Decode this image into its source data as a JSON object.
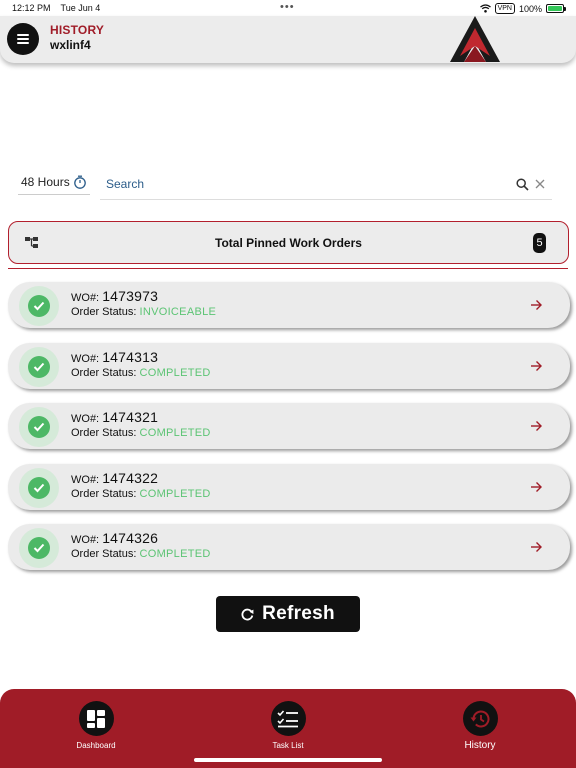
{
  "status_bar": {
    "time": "12:12 PM",
    "date": "Tue Jun 4",
    "dots": "•••",
    "vpn": "VPN",
    "battery_text": "100%",
    "battery_level": 1.0
  },
  "header": {
    "title": "HISTORY",
    "subtitle": "wxlinf4"
  },
  "filters": {
    "hours_label": "48 Hours",
    "search_placeholder": "Search"
  },
  "pinned": {
    "label": "Total Pinned Work Orders",
    "count": "5"
  },
  "work_orders": [
    {
      "prefix": "WO#:",
      "number": "1473973",
      "status_label": "Order Status:",
      "status": "INVOICEABLE"
    },
    {
      "prefix": "WO#:",
      "number": "1474313",
      "status_label": "Order Status:",
      "status": "COMPLETED"
    },
    {
      "prefix": "WO#:",
      "number": "1474321",
      "status_label": "Order Status:",
      "status": "COMPLETED"
    },
    {
      "prefix": "WO#:",
      "number": "1474322",
      "status_label": "Order Status:",
      "status": "COMPLETED"
    },
    {
      "prefix": "WO#:",
      "number": "1474326",
      "status_label": "Order Status:",
      "status": "COMPLETED"
    }
  ],
  "refresh_label": "Refresh",
  "nav": {
    "dashboard": "Dashboard",
    "task_list": "Task List",
    "history": "History"
  },
  "colors": {
    "brand_red": "#a01c27",
    "status_green": "#5cc474",
    "search_blue": "#2c5d8a"
  },
  "icons": {
    "menu": "hamburger-icon",
    "timer": "stopwatch-icon",
    "search": "search-icon",
    "clear": "close-icon",
    "pinned": "hierarchy-icon",
    "check": "check-circle-icon",
    "arrow": "arrow-right-icon",
    "refresh": "refresh-icon",
    "dashboard": "grid-icon",
    "task_list": "checklist-icon",
    "history": "history-icon"
  }
}
